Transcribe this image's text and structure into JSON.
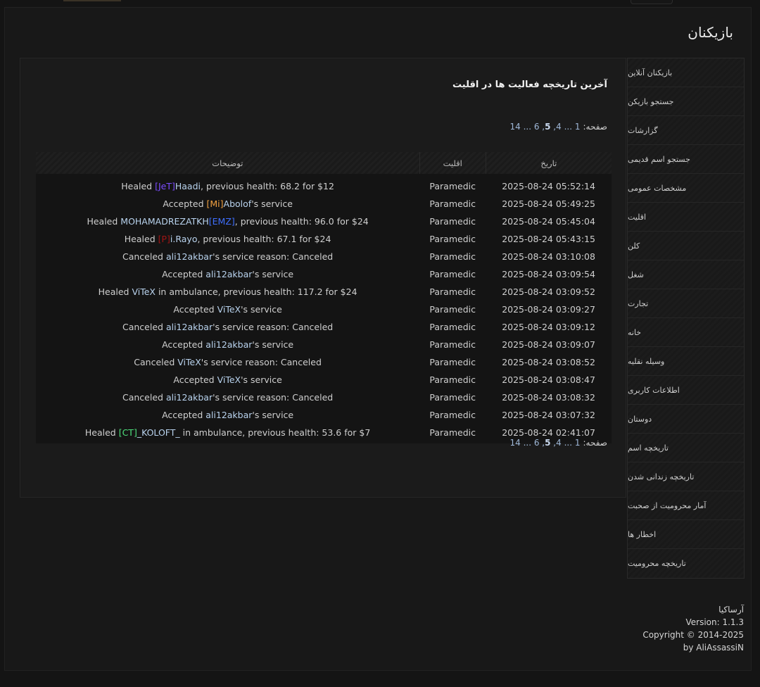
{
  "page": {
    "title": "بازیکنان"
  },
  "sidebar": {
    "items": [
      "بازیکنان آنلاین",
      "جستجو بازیکن",
      "گزارشات",
      "جستجو اسم قدیمی",
      "مشخصات عمومی",
      "اقلیت",
      "کلن",
      "شغل",
      "تجارت",
      "خانه",
      "وسیله نقلیه",
      "اطلاعات کاربری",
      "دوستان",
      "تاریخچه اسم",
      "تاریخچه زندانی شدن",
      "آمار محرومیت از صحبت",
      "اخطار ها",
      "تاریخچه محرومیت"
    ]
  },
  "panel": {
    "title": "آخرین تاریخچه فعالیت ها در اقلیت",
    "pager": {
      "label": "صفحه:",
      "p1": "1",
      "dots1": "...",
      "p4": "4",
      "p5": "5",
      "p6": "6",
      "dots2": "...",
      "p14": "14"
    },
    "table": {
      "headers": {
        "date": "تاریخ",
        "faction": "اقلیت",
        "desc": "توضیحات"
      },
      "rows": [
        {
          "date": "2025-08-24 05:52:14",
          "faction": "Paramedic",
          "pre": "Healed ",
          "tag": "[JeT]",
          "player": "Haadi",
          "post": ", previous health: 68.2 for $12"
        },
        {
          "date": "2025-08-24 05:49:25",
          "faction": "Paramedic",
          "pre": "Accepted ",
          "tag": "[Mi]",
          "player": "Abolof",
          "post": "'s service"
        },
        {
          "date": "2025-08-24 05:45:04",
          "faction": "Paramedic",
          "pre": "Healed ",
          "tag": "",
          "player": "MOHAMADREZATKH",
          "tag2": "[EMZ]",
          "post": ", previous health: 96.0 for $24"
        },
        {
          "date": "2025-08-24 05:43:15",
          "faction": "Paramedic",
          "pre": "Healed ",
          "tag": "[P]",
          "player": "i.Rayo",
          "post": ", previous health: 67.1 for $24"
        },
        {
          "date": "2025-08-24 03:10:08",
          "faction": "Paramedic",
          "pre": "Canceled ",
          "tag": "",
          "player": "ali12akbar",
          "post": "'s service reason: Canceled"
        },
        {
          "date": "2025-08-24 03:09:54",
          "faction": "Paramedic",
          "pre": "Accepted ",
          "tag": "",
          "player": "ali12akbar",
          "post": "'s service"
        },
        {
          "date": "2025-08-24 03:09:52",
          "faction": "Paramedic",
          "pre": "Healed ",
          "tag": "",
          "player": "ViTeX",
          "post": " in ambulance, previous health: 117.2 for $24"
        },
        {
          "date": "2025-08-24 03:09:27",
          "faction": "Paramedic",
          "pre": "Accepted ",
          "tag": "",
          "player": "ViTeX",
          "post": "'s service"
        },
        {
          "date": "2025-08-24 03:09:12",
          "faction": "Paramedic",
          "pre": "Canceled ",
          "tag": "",
          "player": "ali12akbar",
          "post": "'s service reason: Canceled"
        },
        {
          "date": "2025-08-24 03:09:07",
          "faction": "Paramedic",
          "pre": "Accepted ",
          "tag": "",
          "player": "ali12akbar",
          "post": "'s service"
        },
        {
          "date": "2025-08-24 03:08:52",
          "faction": "Paramedic",
          "pre": "Canceled ",
          "tag": "",
          "player": "ViTeX",
          "post": "'s service reason: Canceled"
        },
        {
          "date": "2025-08-24 03:08:47",
          "faction": "Paramedic",
          "pre": "Accepted ",
          "tag": "",
          "player": "ViTeX",
          "post": "'s service"
        },
        {
          "date": "2025-08-24 03:08:32",
          "faction": "Paramedic",
          "pre": "Canceled ",
          "tag": "",
          "player": "ali12akbar",
          "post": "'s service reason: Canceled"
        },
        {
          "date": "2025-08-24 03:07:32",
          "faction": "Paramedic",
          "pre": "Accepted ",
          "tag": "",
          "player": "ali12akbar",
          "post": "'s service"
        },
        {
          "date": "2025-08-24 02:41:07",
          "faction": "Paramedic",
          "pre": "Healed ",
          "tag": "[CT]",
          "player": "_KOLOFT_",
          "post": " in ambulance, previous health: 53.6 for $7"
        }
      ]
    }
  },
  "footer": {
    "site": "آرساکیا",
    "version": "Version: 1.1.3",
    "copyright": "Copyright © 2014-2025",
    "author": "by AliAssassiN"
  },
  "colors": {
    "faction": "#ff3b3b",
    "player": "#b9d3ee",
    "tag_jet": "#7b4dff",
    "tag_mi": "#f0a040",
    "tag_emz": "#3f6fff",
    "tag_p": "#a11515",
    "tag_ct": "#4ee07c"
  }
}
